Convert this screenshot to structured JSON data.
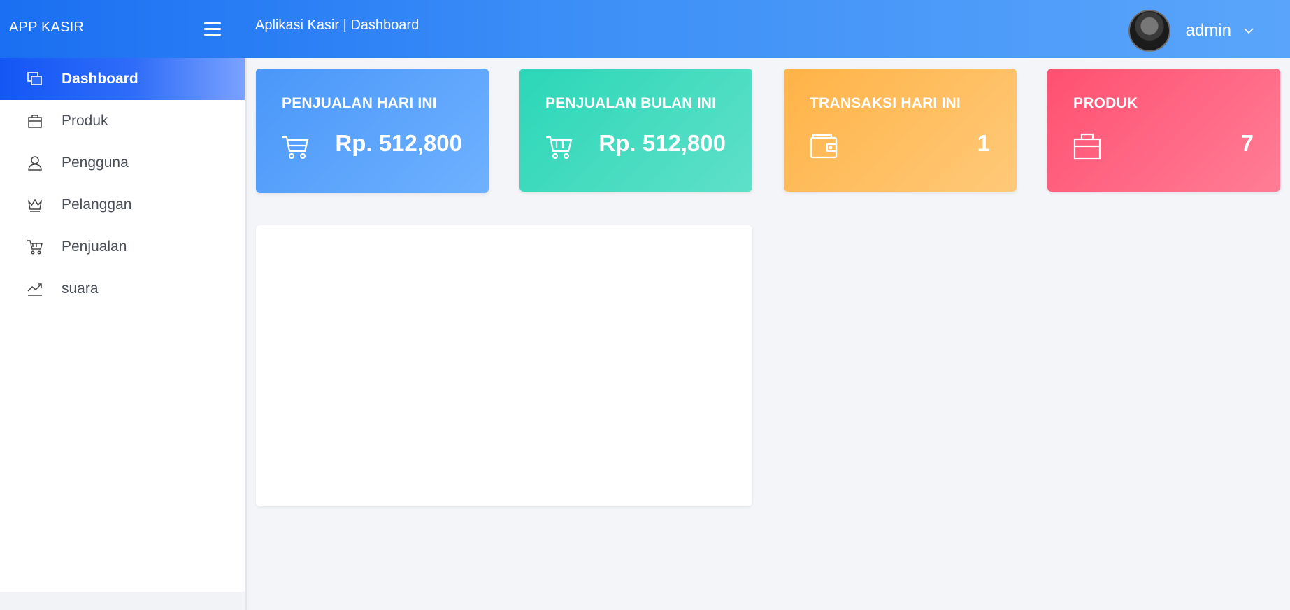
{
  "header": {
    "brand": "APP KASIR",
    "page_title": "Aplikasi Kasir | Dashboard",
    "user_name": "admin"
  },
  "sidebar": {
    "items": [
      {
        "label": "Dashboard",
        "icon": "dashboard-icon",
        "active": true
      },
      {
        "label": "Produk",
        "icon": "briefcase-icon"
      },
      {
        "label": "Pengguna",
        "icon": "user-icon"
      },
      {
        "label": "Pelanggan",
        "icon": "crown-icon"
      },
      {
        "label": "Penjualan",
        "icon": "cart-icon"
      },
      {
        "label": "suara",
        "icon": "trend-chart-icon"
      }
    ]
  },
  "cards": [
    {
      "title": "PENJUALAN HARI INI",
      "value": "Rp. 512,800",
      "icon": "cart-icon",
      "color": "#4a97f9"
    },
    {
      "title": "PENJUALAN BULAN INI",
      "value": "Rp. 512,800",
      "icon": "cart-icon",
      "color": "#2bd7b7"
    },
    {
      "title": "TRANSAKSI HARI INI",
      "value": "1",
      "icon": "wallet-icon",
      "color": "#ffb347"
    },
    {
      "title": "PRODUK",
      "value": "7",
      "icon": "briefcase-icon",
      "color": "#ff5071"
    }
  ],
  "colors": {
    "accent": "#1a6ff2",
    "background": "#f4f5f9"
  }
}
